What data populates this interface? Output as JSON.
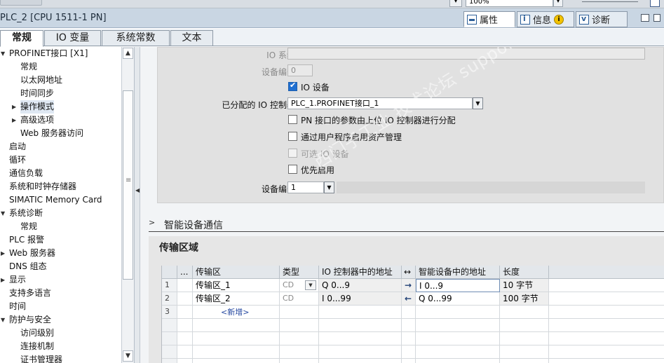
{
  "topbar": {
    "zoom_value": "100%"
  },
  "titlebar": {
    "title": "PLC_2 [CPU 1511-1 PN]"
  },
  "panel_tabs": [
    {
      "label": "属性",
      "icon": "properties-icon"
    },
    {
      "label": "信息",
      "icon": "info-icon",
      "badge": "i"
    },
    {
      "label": "诊断",
      "icon": "diagnostics-icon"
    }
  ],
  "main_tabs": [
    "常规",
    "IO 变量",
    "系统常数",
    "文本"
  ],
  "nav": [
    {
      "label": "PROFINET接口 [X1]",
      "level": 0,
      "toggle": "expanded"
    },
    {
      "label": "常规",
      "level": 1
    },
    {
      "label": "以太网地址",
      "level": 1
    },
    {
      "label": "时间同步",
      "level": 1
    },
    {
      "label": "操作模式",
      "level": 1,
      "toggle": "collapsed",
      "selected": true
    },
    {
      "label": "高级选项",
      "level": 1,
      "toggle": "collapsed"
    },
    {
      "label": "Web 服务器访问",
      "level": 1
    },
    {
      "label": "启动",
      "level": 0
    },
    {
      "label": "循环",
      "level": 0
    },
    {
      "label": "通信负载",
      "level": 0
    },
    {
      "label": "系统和时钟存储器",
      "level": 0
    },
    {
      "label": "SIMATIC Memory Card",
      "level": 0
    },
    {
      "label": "系统诊断",
      "level": 0,
      "toggle": "expanded"
    },
    {
      "label": "常规",
      "level": 1
    },
    {
      "label": "PLC 报警",
      "level": 0
    },
    {
      "label": "Web 服务器",
      "level": 0,
      "toggle": "collapsed"
    },
    {
      "label": "DNS 组态",
      "level": 0
    },
    {
      "label": "显示",
      "level": 0,
      "toggle": "collapsed"
    },
    {
      "label": "支持多语言",
      "level": 0
    },
    {
      "label": "时间",
      "level": 0
    },
    {
      "label": "防护与安全",
      "level": 0,
      "toggle": "expanded"
    },
    {
      "label": "访问级别",
      "level": 1
    },
    {
      "label": "连接机制",
      "level": 1
    },
    {
      "label": "证书管理器",
      "level": 1
    }
  ],
  "form": {
    "io_system_label": "IO 系统:",
    "io_system_value": "",
    "device_number_label": "设备编号:",
    "device_number_value": "0",
    "io_device_label": "IO 设备",
    "io_device_checked": true,
    "assigned_controller_label": "已分配的 IO 控制器:",
    "assigned_controller_value": "PLC_1.PROFINET接口_1",
    "pn_param_label": "PN 接口的参数由上位 IO 控制器进行分配",
    "user_program_label": "通过用户程序启用资产管理",
    "optional_io_label": "可选 IO 设备",
    "priority_label": "优先启用",
    "device_number2_label": "设备编号:",
    "device_number2_value": "1"
  },
  "smart_device_section": {
    "title": "智能设备通信"
  },
  "transfer": {
    "title": "传输区域",
    "columns": [
      "...",
      "传输区",
      "类型",
      "IO 控制器中的地址",
      "↔",
      "智能设备中的地址",
      "长度"
    ],
    "rows": [
      {
        "num": "1",
        "name": "传输区_1",
        "type": "CD",
        "ctrl_addr": "Q 0...9",
        "dir": "→",
        "dev_addr": "I 0...9",
        "length": "10 字节"
      },
      {
        "num": "2",
        "name": "传输区_2",
        "type": "CD",
        "ctrl_addr": "I 0...99",
        "dir": "←",
        "dev_addr": "Q 0...99",
        "length": "100 字节"
      },
      {
        "num": "3",
        "name": "<新增>",
        "type": "",
        "ctrl_addr": "",
        "dir": "",
        "dev_addr": "",
        "length": ""
      }
    ]
  },
  "watermark": "西门子工业 技术论坛 support.industry.siemens.com/cs"
}
